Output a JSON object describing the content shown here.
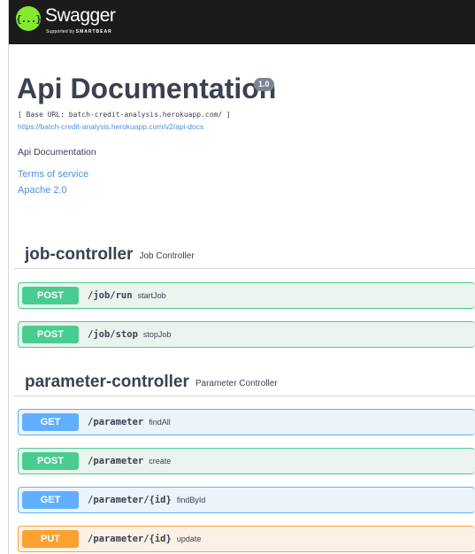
{
  "header": {
    "brand": "Swagger",
    "logo_glyph": "{...}",
    "sub_prefix": "Supported by",
    "sub_brand": "SMARTBEAR"
  },
  "info": {
    "title": "Api Documentation",
    "version": "1.0",
    "base_url": "[ Base URL: batch-credit-analysis.herokuapp.com/ ]",
    "docs_url": "https://batch-credit-analysis.herokuapp.com/v2/api-docs",
    "description": "Api Documentation",
    "terms_of_service": "Terms of service",
    "license": "Apache 2.0"
  },
  "tags": [
    {
      "name": "job-controller",
      "description": "Job Controller",
      "operations": [
        {
          "method": "POST",
          "path": "/job/run",
          "summary": "startJob"
        },
        {
          "method": "POST",
          "path": "/job/stop",
          "summary": "stopJob"
        }
      ]
    },
    {
      "name": "parameter-controller",
      "description": "Parameter Controller",
      "operations": [
        {
          "method": "GET",
          "path": "/parameter",
          "summary": "findAll"
        },
        {
          "method": "POST",
          "path": "/parameter",
          "summary": "create"
        },
        {
          "method": "GET",
          "path": "/parameter/{id}",
          "summary": "findById"
        },
        {
          "method": "PUT",
          "path": "/parameter/{id}",
          "summary": "update"
        }
      ]
    }
  ],
  "colors": {
    "post": "#49cc90",
    "get": "#61affe",
    "put": "#fca130",
    "link": "#4990e2",
    "topbar": "#1b1b1b",
    "logo": "#85ea2d"
  }
}
